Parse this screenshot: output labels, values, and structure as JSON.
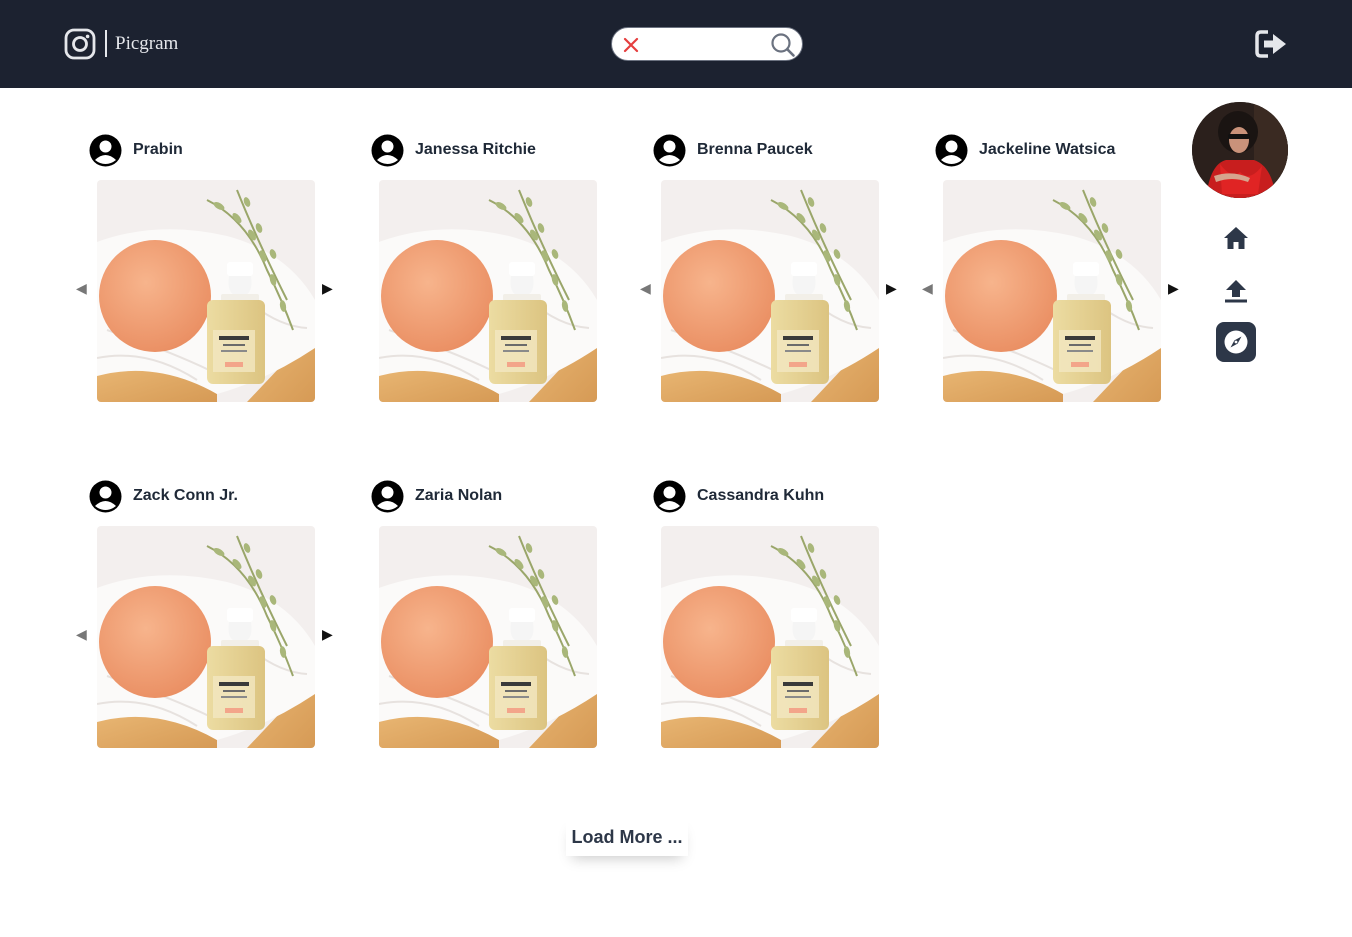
{
  "header": {
    "app_name": "Picgram",
    "logo_icon": "instagram-icon",
    "search": {
      "value": "",
      "placeholder": "",
      "clear_icon": "close-icon",
      "submit_icon": "search-icon"
    },
    "logout_icon": "sign-out-icon"
  },
  "sidebar": {
    "profile_icon": "profile-avatar",
    "items": [
      {
        "icon": "home-icon",
        "active": false
      },
      {
        "icon": "upload-icon",
        "active": false
      },
      {
        "icon": "compass-icon",
        "active": true
      }
    ]
  },
  "posts": [
    {
      "author": "Prabin",
      "has_prev": true,
      "has_next": true
    },
    {
      "author": "Janessa Ritchie",
      "has_prev": false,
      "has_next": false
    },
    {
      "author": "Brenna Paucek",
      "has_prev": true,
      "has_next": true
    },
    {
      "author": "Jackeline Watsica",
      "has_prev": true,
      "has_next": true
    },
    {
      "author": "Zack Conn Jr.",
      "has_prev": true,
      "has_next": true
    },
    {
      "author": "Zaria Nolan",
      "has_prev": false,
      "has_next": false
    },
    {
      "author": "Cassandra Kuhn",
      "has_prev": false,
      "has_next": false
    }
  ],
  "carousel": {
    "prev_glyph": "◀",
    "next_glyph": "▶"
  },
  "load_more_label": "Load More ...",
  "colors": {
    "header_bg": "#1c2230",
    "text_dark": "#1f2937",
    "search_clear": "#e53e3e",
    "active_nav_bg": "#2d3748"
  }
}
